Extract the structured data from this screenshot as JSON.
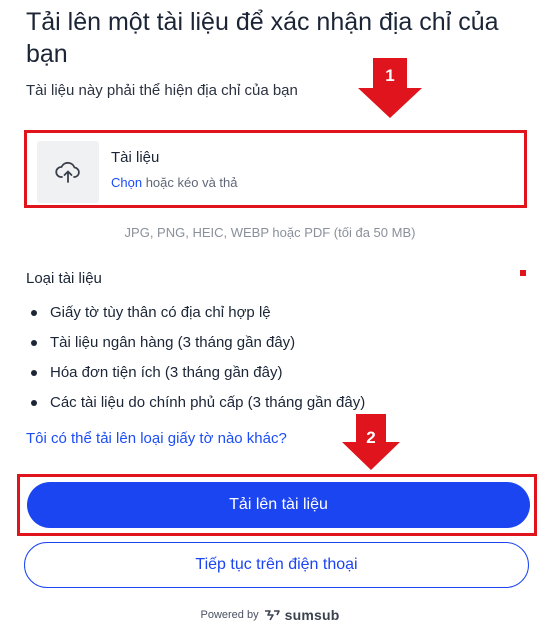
{
  "header": {
    "title": "Tải lên một tài liệu để xác nhận địa chỉ của bạn",
    "subtitle": "Tài liệu này phải thể hiện địa chỉ của bạn"
  },
  "annotations": {
    "arrow_1_label": "1",
    "arrow_2_label": "2",
    "highlight_color": "#e0141c"
  },
  "upload": {
    "icon": "cloud-upload-icon",
    "title": "Tài liệu",
    "choose_label": "Chọn",
    "drag_hint": "hoặc kéo và thả",
    "formats": "JPG, PNG, HEIC, WEBP hoặc PDF (tối đa 50 MB)"
  },
  "doc_types": {
    "title": "Loại tài liệu",
    "items": [
      "Giấy tờ tùy thân có địa chỉ hợp lệ",
      "Tài liệu ngân hàng (3 tháng gần đây)",
      "Hóa đơn tiện ích (3 tháng gần đây)",
      "Các tài liệu do chính phủ cấp (3 tháng gần đây)"
    ]
  },
  "other_link": "Tôi có thể tải lên loại giấy tờ nào khác?",
  "actions": {
    "upload_label": "Tải lên tài liệu",
    "phone_label": "Tiếp tục trên điện thoại"
  },
  "footer": {
    "powered_by": "Powered by",
    "brand": "sumsub",
    "brand_icon": "sumsub-logo-icon"
  },
  "colors": {
    "accent": "#1c45f2",
    "link": "#1c4df5"
  }
}
